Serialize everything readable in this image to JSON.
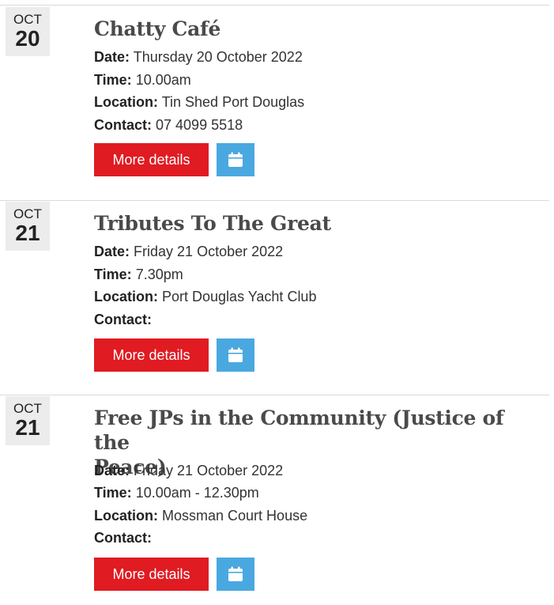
{
  "events": [
    {
      "month": "OCT",
      "day": "20",
      "title": "Chatty Café",
      "date_label": "Date:",
      "date_value": "Thursday 20 October 2022",
      "time_label": "Time:",
      "time_value": "10.00am",
      "location_label": "Location:",
      "location_value": "Tin Shed Port Douglas",
      "contact_label": "Contact:",
      "contact_value": "07 4099 5518",
      "more_label": "More details",
      "calendar_icon": "calendar-icon"
    },
    {
      "month": "OCT",
      "day": "21",
      "title": "Tributes To The Great",
      "date_label": "Date:",
      "date_value": "Friday 21 October 2022",
      "time_label": "Time:",
      "time_value": "7.30pm",
      "location_label": "Location:",
      "location_value": "Port Douglas Yacht Club",
      "contact_label": "Contact:",
      "contact_value": "",
      "more_label": "More details",
      "calendar_icon": "calendar-icon"
    },
    {
      "month": "OCT",
      "day": "21",
      "title_line1": "Free JPs in the Community (Justice of the",
      "title_line2": "Peace)",
      "date_label": "Date:",
      "date_value": "Friday 21 October 2022",
      "time_label": "Time:",
      "time_value": "10.00am - 12.30pm",
      "location_label": "Location:",
      "location_value": "Mossman Court House",
      "contact_label": "Contact:",
      "contact_value": "",
      "more_label": "More details",
      "calendar_icon": "calendar-icon"
    }
  ],
  "colors": {
    "more_button": "#e01b22",
    "calendar_button": "#4aa8e0",
    "date_box": "#ececec"
  }
}
